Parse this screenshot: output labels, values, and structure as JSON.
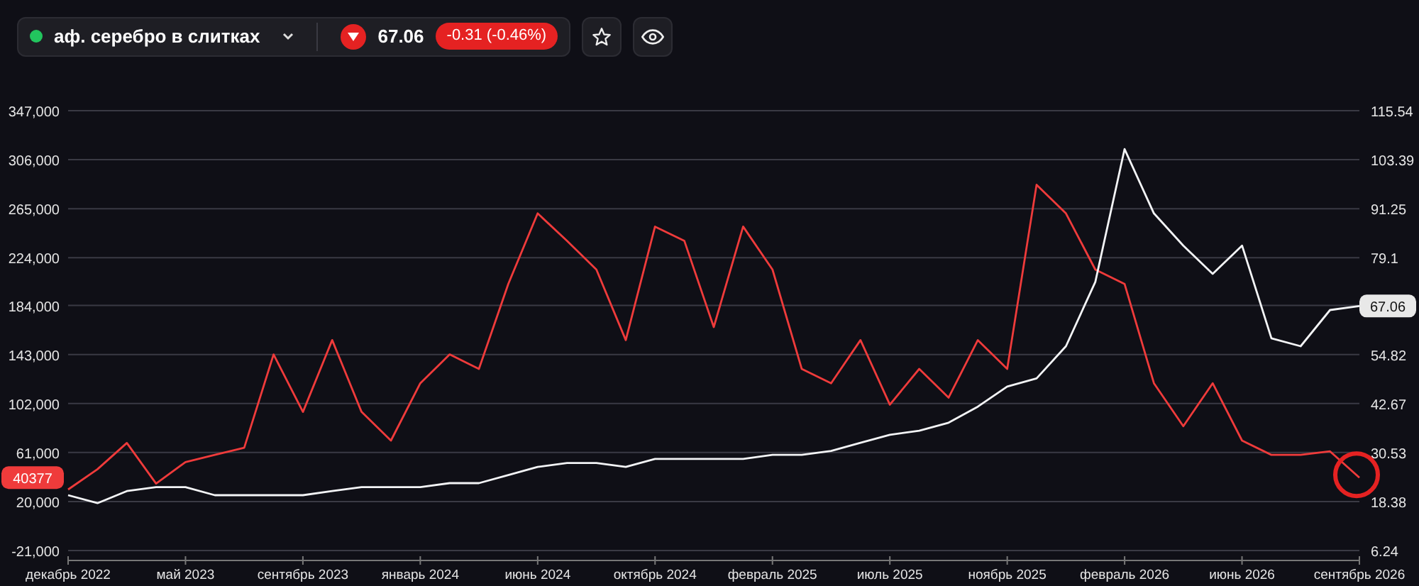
{
  "instrument": {
    "name": "аф. серебро в слитках",
    "price": "67.06",
    "change": "-0.31 (-0.46%)",
    "falling": true
  },
  "chart": {
    "chart_data": {
      "type": "line",
      "categories": [
        "декабрь 2022",
        null,
        null,
        null,
        "май 2023",
        null,
        null,
        null,
        "сентябрь 2023",
        null,
        null,
        null,
        "январь 2024",
        null,
        null,
        null,
        "июнь 2024",
        null,
        null,
        null,
        "октябрь 2024",
        null,
        null,
        null,
        "февраль 2025",
        null,
        null,
        null,
        "июль 2025",
        null,
        null,
        null,
        "ноябрь 2025",
        null,
        null,
        null,
        "февраль 2026",
        null,
        null,
        null,
        "июнь 2026",
        null,
        null,
        null,
        "сентябрь 2026"
      ],
      "ylim": [
        -21000,
        347000
      ],
      "yticks": [
        {
          "value": 347000,
          "label": "347,000"
        },
        {
          "value": 306000,
          "label": "306,000"
        },
        {
          "value": 265000,
          "label": "265,000"
        },
        {
          "value": 224000,
          "label": "224,000"
        },
        {
          "value": 184000,
          "label": "184,000"
        },
        {
          "value": 143000,
          "label": "143,000"
        },
        {
          "value": 102000,
          "label": "102,000"
        },
        {
          "value": 61000,
          "label": "61,000"
        },
        {
          "value": 20000,
          "label": "20,000"
        },
        {
          "value": -21000,
          "label": "-21,000"
        }
      ],
      "y2lim": [
        6.24,
        115.54
      ],
      "y2ticks": [
        115.54,
        103.39,
        91.25,
        79.1,
        54.82,
        42.67,
        30.53,
        18.38,
        6.24
      ],
      "series": [
        {
          "color": "#ef3b3b",
          "values": [
            30000,
            47000,
            69000,
            35000,
            53000,
            59000,
            65000,
            143000,
            95000,
            155000,
            95000,
            71000,
            119000,
            143000,
            131000,
            202000,
            261000,
            238000,
            214000,
            155000,
            250000,
            238000,
            166000,
            250000,
            214000,
            131000,
            119000,
            155000,
            101000,
            131000,
            107000,
            155000,
            131000,
            285000,
            261000,
            214000,
            202000,
            119000,
            83000,
            119000,
            71000,
            59000,
            59000,
            62000,
            40000
          ]
        },
        {
          "axis": "y2",
          "color": "#f3f4f6",
          "values": [
            20,
            18,
            21,
            22,
            22,
            20,
            20,
            20,
            20,
            21,
            22,
            22,
            22,
            23,
            23,
            25,
            27,
            28,
            28,
            27,
            29,
            29,
            29,
            29,
            30,
            30,
            31,
            33,
            35,
            36,
            38,
            42,
            47,
            49,
            57,
            73,
            106,
            90,
            82,
            75,
            82,
            59,
            57,
            66,
            67
          ]
        }
      ],
      "grid": true
    },
    "last_value_badges": [
      "40377",
      "67.06"
    ],
    "last_point_circled": true
  }
}
